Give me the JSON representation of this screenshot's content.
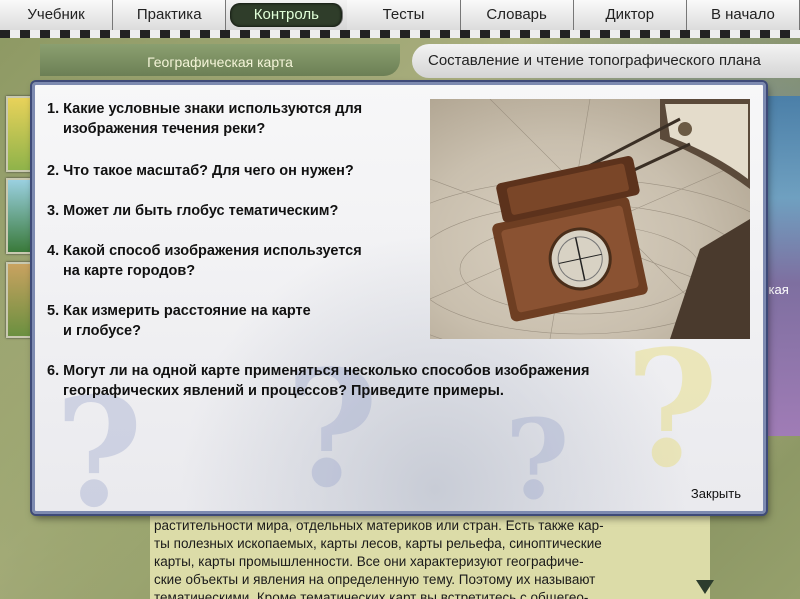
{
  "menu": {
    "items": [
      {
        "label": "Учебник",
        "active": false
      },
      {
        "label": "Практика",
        "active": false
      },
      {
        "label": "Контроль",
        "active": true
      },
      {
        "label": "Тесты",
        "active": false
      },
      {
        "label": "Словарь",
        "active": false
      },
      {
        "label": "Диктор",
        "active": false
      },
      {
        "label": "В начало",
        "active": false
      }
    ]
  },
  "header": {
    "section": "Географическая карта",
    "topic": "Составление и чтение топографического плана"
  },
  "sidemap": {
    "label": "ская"
  },
  "dialog": {
    "questions": [
      {
        "line1": "1. Какие условные знаки используются для",
        "line2": "изображения течения реки?"
      },
      {
        "line1": "2. Что такое масштаб? Для чего он нужен?",
        "line2": ""
      },
      {
        "line1": "3. Может ли быть глобус тематическим?",
        "line2": ""
      },
      {
        "line1": "4. Какой способ изображения используется",
        "line2": "на карте городов?"
      },
      {
        "line1": "5. Как измерить расстояние на карте",
        "line2": "и глобусе?"
      },
      {
        "line1": "6. Могут ли на одной карте применяться несколько способов изображения",
        "line2": "географических явлений и процессов? Приведите примеры."
      }
    ],
    "close_label": "Закрыть"
  },
  "textbook": {
    "lines": [
      "растительности мира, отдельных материков или стран. Есть также кар-",
      "ты полезных ископаемых, карты лесов, карты рельефа, синоптические",
      "карты, карты промышленности. Все они характеризуют географиче-",
      "ские объекты и явления на определенную тему. Поэтому их называют",
      "тематическими. Кроме тематических карт вы встретитесь с общегео-"
    ]
  },
  "colors": {
    "menu_active_bg": "#2f3d2a",
    "dialog_border": "#3e4a78",
    "text_panel_bg": "#dcdca8"
  }
}
